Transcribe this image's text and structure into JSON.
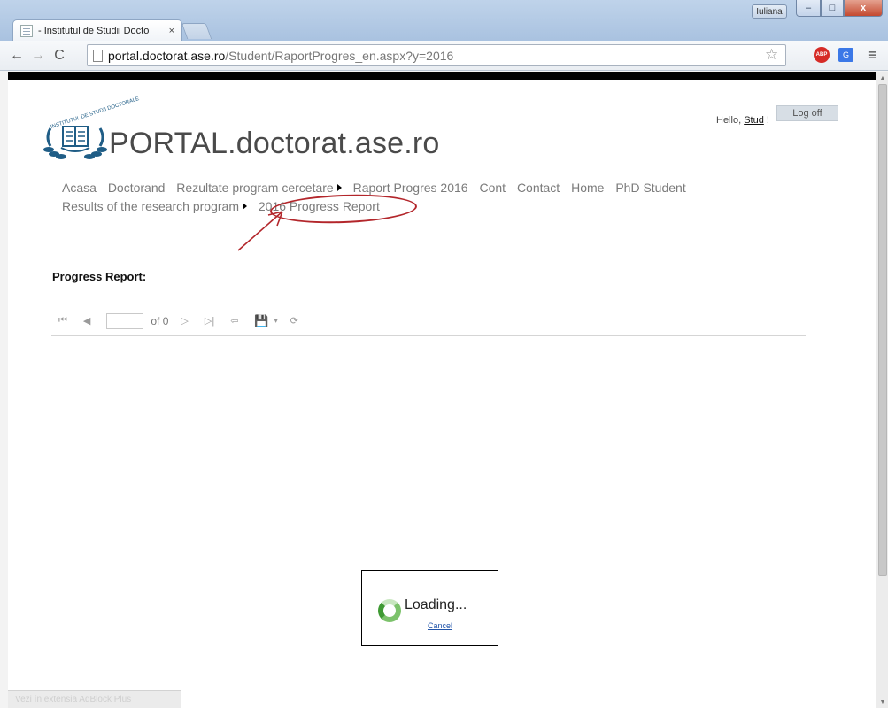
{
  "browser": {
    "tab_title": "- Institutul de Studii Docto",
    "tab_close": "×",
    "user_badge": "Iuliana",
    "url_host": "portal.doctorat.ase.ro",
    "url_path": "/Student/RaportProgres_en.aspx?y=2016",
    "ext_abp_label": "ABP",
    "ext_translate_label": "G",
    "status_text": "Vezi în extensia AdBlock Plus"
  },
  "window_controls": {
    "minimize": "–",
    "maximize": "□",
    "close": "x"
  },
  "header": {
    "logo_text": "INSTITUTUL DE STUDII DOCTORALE",
    "site_title": "PORTAL.doctorat.ase.ro",
    "hello_prefix": "Hello,",
    "user_name": "Stud",
    "hello_suffix": "!",
    "logoff_label": "Log off"
  },
  "nav": {
    "items": [
      {
        "label": "Acasa",
        "submenu": false
      },
      {
        "label": "Doctorand",
        "submenu": false
      },
      {
        "label": "Rezultate program cercetare",
        "submenu": true
      },
      {
        "label": "Raport Progres 2016",
        "submenu": false
      },
      {
        "label": "Cont",
        "submenu": false
      },
      {
        "label": "Contact",
        "submenu": false
      },
      {
        "label": "Home",
        "submenu": false
      },
      {
        "label": "PhD Student",
        "submenu": false
      },
      {
        "label": "Results of the research program",
        "submenu": true
      },
      {
        "label": "2016 Progress Report",
        "submenu": false
      }
    ]
  },
  "report": {
    "section_title": "Progress Report:",
    "page_value": "",
    "of_text": "of 0",
    "btn_first": "⏮",
    "btn_prev": "◀",
    "btn_next": "▷",
    "btn_last": "▷|",
    "btn_back": "⇦",
    "btn_save": "💾",
    "btn_dropdown": "▾",
    "btn_refresh": "⟳"
  },
  "loading": {
    "text": "Loading...",
    "cancel_label": "Cancel"
  },
  "colors": {
    "annotation_red": "#b3262b",
    "spinner_green": "#7cc26b",
    "logo_blue": "#1f5d86"
  }
}
